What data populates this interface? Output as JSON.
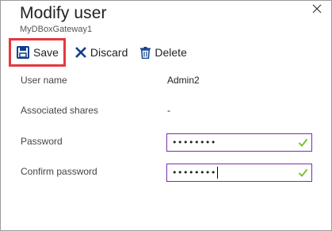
{
  "window": {
    "title": "Modify user",
    "subtitle": "MyDBoxGateway1"
  },
  "toolbar": {
    "save_label": "Save",
    "discard_label": "Discard",
    "delete_label": "Delete"
  },
  "form": {
    "user_name_label": "User name",
    "user_name_value": "Admin2",
    "associated_shares_label": "Associated shares",
    "associated_shares_value": "-",
    "password_label": "Password",
    "password_value": "••••••••",
    "confirm_password_label": "Confirm password",
    "confirm_password_value": "••••••••"
  },
  "colors": {
    "highlight": "#e5383e",
    "accent": "#0f3f8c",
    "field_border": "#7b2ea8",
    "valid_check": "#7ab929"
  },
  "icons": {
    "close": "close-icon",
    "save": "save-icon",
    "discard": "discard-icon",
    "delete": "delete-icon",
    "valid": "checkmark-icon"
  }
}
